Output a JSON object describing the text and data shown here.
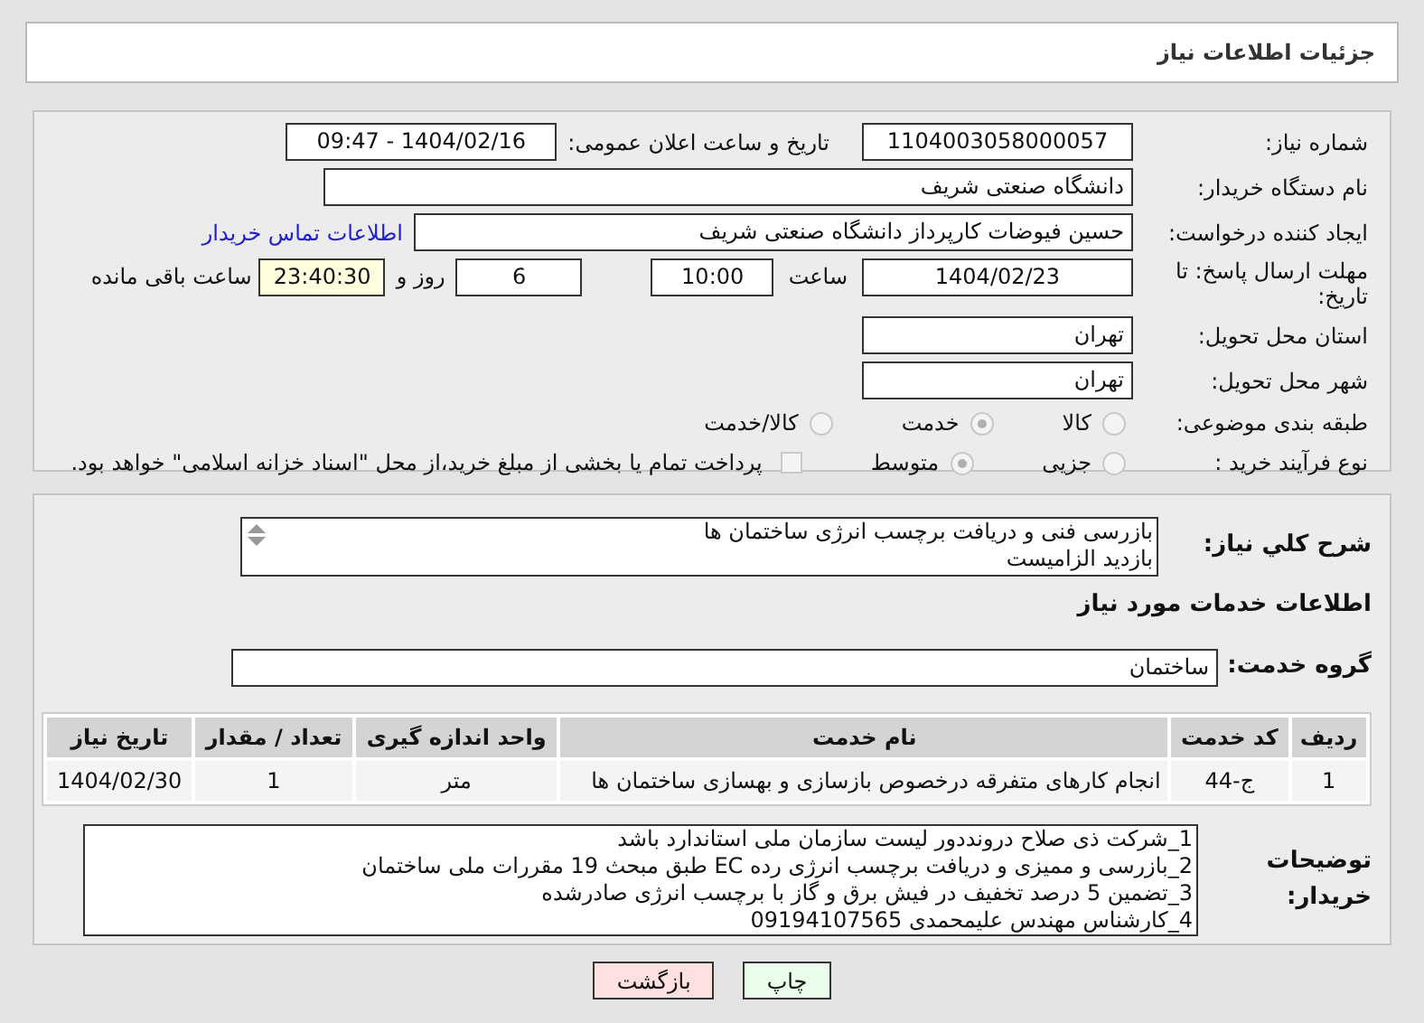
{
  "header": {
    "title": "جزئیات اطلاعات نیاز"
  },
  "need_number": {
    "label": "شماره نیاز:",
    "value": "1104003058000057"
  },
  "announce": {
    "label": "تاریخ و ساعت اعلان عمومی:",
    "value": "1404/02/16 - 09:47"
  },
  "buyer": {
    "label": "نام دستگاه خریدار:",
    "value": "دانشگاه صنعتی شریف"
  },
  "requester": {
    "label": "ایجاد کننده درخواست:",
    "value": "حسین فیوضات کارپرداز دانشگاه صنعتی شریف",
    "link": "اطلاعات تماس خریدار"
  },
  "deadline": {
    "label": "مهلت ارسال پاسخ: تا تاریخ:",
    "date": "1404/02/23",
    "time_label": "ساعت",
    "time": "10:00",
    "days": "6",
    "days_label": "روز و",
    "remaining": "23:40:30",
    "remaining_label": "ساعت باقی مانده"
  },
  "province": {
    "label": "استان محل تحویل:",
    "value": "تهران"
  },
  "city": {
    "label": "شهر محل تحویل:",
    "value": "تهران"
  },
  "category": {
    "label": "طبقه بندی موضوعی:",
    "options": [
      {
        "label": "کالا",
        "selected": false
      },
      {
        "label": "خدمت",
        "selected": true
      },
      {
        "label": "کالا/خدمت",
        "selected": false
      }
    ]
  },
  "process": {
    "label": "نوع فرآیند خرید :",
    "options": [
      {
        "label": "جزیی",
        "selected": false
      },
      {
        "label": "متوسط",
        "selected": true
      }
    ],
    "payment": {
      "label": "پرداخت تمام یا بخشی از مبلغ خرید،از محل \"اسناد خزانه اسلامی\" خواهد بود.",
      "checked": false
    }
  },
  "summary": {
    "label": "شرح کلي نياز:",
    "lines": [
      "بازرسی فنی و دریافت برچسب انرژی ساختمان ها",
      "بازدید الزامیست"
    ]
  },
  "services_title": "اطلاعات خدمات مورد نیاز",
  "service_group": {
    "label": "گروه خدمت:",
    "value": "ساختمان"
  },
  "table": {
    "columns": [
      "ردیف",
      "کد خدمت",
      "نام خدمت",
      "واحد اندازه گیری",
      "تعداد / مقدار",
      "تاریخ نیاز"
    ],
    "rows": [
      [
        "1",
        "ج-44",
        "انجام کارهای متفرقه درخصوص بازسازی و بهسازی ساختمان ها",
        "متر",
        "1",
        "1404/02/30"
      ]
    ]
  },
  "buyer_notes": {
    "label": "توضیحات خریدار:",
    "lines": [
      "1_شرکت ذی صلاح درونددور لیست سازمان ملی استاندارد باشد",
      "2_بازرسی و ممیزی و دریافت برچسب انرژی رده EC طبق مبحث 19 مقررات ملی ساختمان",
      "3_تضمین 5 درصد تخفیف در فیش برق و گاز با برچسب انرژی صادرشده",
      "4_کارشناس مهندس علیمحمدی 09194107565"
    ]
  },
  "buttons": [
    {
      "label": "چاپ",
      "kind": "print"
    },
    {
      "label": "بازگشت",
      "kind": "back"
    }
  ]
}
